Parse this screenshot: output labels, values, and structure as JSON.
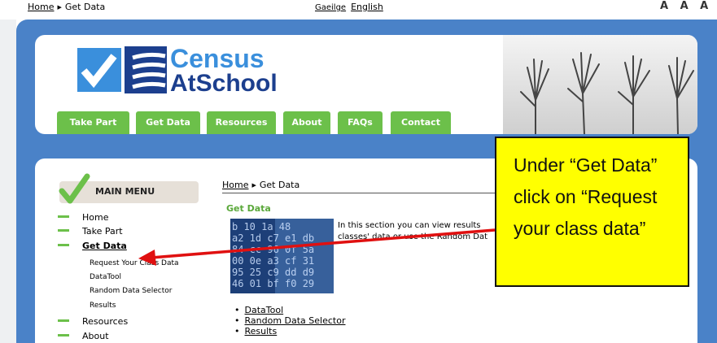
{
  "top": {
    "home": "Home",
    "current": "Get Data",
    "lang_ga": "Gaeilge",
    "lang_en": "English",
    "text_size": "A A A"
  },
  "logo": {
    "line1": "Census",
    "line2": "AtSchool"
  },
  "nav": [
    {
      "label": "Take Part"
    },
    {
      "label": "Get Data"
    },
    {
      "label": "Resources"
    },
    {
      "label": "About"
    },
    {
      "label": "FAQs"
    },
    {
      "label": "Contact"
    }
  ],
  "menu": {
    "title": "MAIN MENU",
    "items": [
      "Home",
      "Take Part",
      "Get Data",
      "Resources",
      "About"
    ],
    "sub_items": [
      "Request Your Class Data",
      "DataTool",
      "Random Data Selector",
      "Results"
    ]
  },
  "content": {
    "crumb_home": "Home",
    "crumb_current": "Get Data",
    "title": "Get Data",
    "intro": "In this section you can view results classes' data or use the Random Dat",
    "links": [
      "DataTool",
      "Random Data Selector",
      "Results"
    ]
  },
  "callout": {
    "text": "Under “Get Data” click on “Request your class data”"
  },
  "colors": {
    "frame_blue": "#4a82c8",
    "nav_green": "#6cc04a",
    "callout_yellow": "#ffff00",
    "arrow_red": "#e01010"
  }
}
